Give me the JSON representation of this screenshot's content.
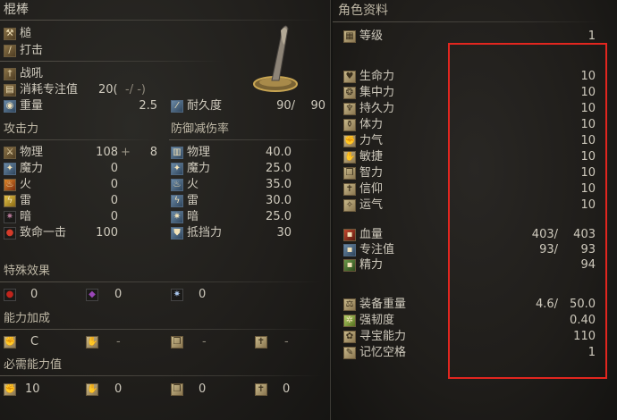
{
  "weapon": {
    "name": "棍棒",
    "category": "槌",
    "attack_type": "打击",
    "skill": "战吼",
    "fp_cost_label": "消耗专注值",
    "fp_cost_value": "20(",
    "fp_cost_rest": "-/ -)",
    "weight_label": "重量",
    "weight_value": "2.5",
    "durability_label": "耐久度",
    "durability_value": "90/",
    "durability_max": "90"
  },
  "attack": {
    "header": "攻击力",
    "rows": [
      {
        "label": "物理",
        "value": "108",
        "extra": "+",
        "bonus": "8"
      },
      {
        "label": "魔力",
        "value": "0"
      },
      {
        "label": "火",
        "value": "0"
      },
      {
        "label": "雷",
        "value": "0"
      },
      {
        "label": "暗",
        "value": "0"
      },
      {
        "label": "致命一击",
        "value": "100"
      }
    ]
  },
  "defense": {
    "header": "防御减伤率",
    "rows": [
      {
        "label": "物理",
        "value": "40.0"
      },
      {
        "label": "魔力",
        "value": "25.0"
      },
      {
        "label": "火",
        "value": "35.0"
      },
      {
        "label": "雷",
        "value": "30.0"
      },
      {
        "label": "暗",
        "value": "25.0"
      },
      {
        "label": "抵挡力",
        "value": "30"
      }
    ]
  },
  "effects": {
    "header": "特殊效果",
    "values": [
      "0",
      "0",
      "0"
    ]
  },
  "scaling": {
    "header": "能力加成",
    "values": [
      "C",
      "-",
      "-",
      "-"
    ]
  },
  "requirements": {
    "header": "必需能力值",
    "values": [
      "10",
      "0",
      "0",
      "0"
    ]
  },
  "character": {
    "header": "角色资料",
    "level_label": "等级",
    "level_value": "1",
    "stats": [
      {
        "label": "生命力",
        "value": "10"
      },
      {
        "label": "集中力",
        "value": "10"
      },
      {
        "label": "持久力",
        "value": "10"
      },
      {
        "label": "体力",
        "value": "10"
      },
      {
        "label": "力气",
        "value": "10"
      },
      {
        "label": "敏捷",
        "value": "10"
      },
      {
        "label": "智力",
        "value": "10"
      },
      {
        "label": "信仰",
        "value": "10"
      },
      {
        "label": "运气",
        "value": "10"
      }
    ],
    "pools": [
      {
        "label": "血量",
        "current": "403/",
        "max": "403"
      },
      {
        "label": "专注值",
        "current": "93/",
        "max": "93"
      },
      {
        "label": "精力",
        "current": "",
        "max": "94"
      }
    ],
    "misc": [
      {
        "label": "装备重量",
        "current": "4.6/",
        "max": "50.0"
      },
      {
        "label": "强韧度",
        "current": "",
        "max": "0.40"
      },
      {
        "label": "寻宝能力",
        "current": "",
        "max": "110"
      },
      {
        "label": "记忆空格",
        "current": "",
        "max": "1"
      }
    ]
  },
  "colors": {
    "highlight": "#e2261f",
    "text": "#cfcabd",
    "background": "#211f1c"
  }
}
